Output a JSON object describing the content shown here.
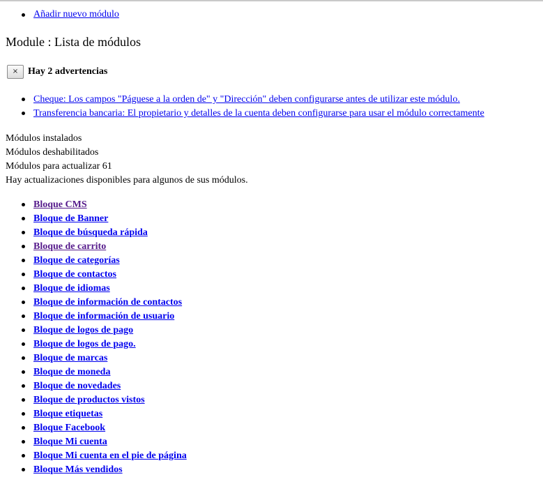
{
  "add_module_link": "Añadir nuevo módulo",
  "page_title": "Module : Lista de módulos",
  "warnings": {
    "close_symbol": "×",
    "title": "Hay 2 advertencias",
    "items": [
      "Cheque: Los campos \"Páguese a la orden de\" y \"Dirección\" deben configurarse antes de utilizar este módulo.",
      "Transferencia bancaria: El propietario y detalles de la cuenta deben configurarse para usar el módulo correctamente"
    ]
  },
  "status": {
    "installed": "Módulos instalados",
    "disabled": "Módulos deshabilitados",
    "to_update": "Módulos para actualizar 61",
    "updates_notice": "Hay actualizaciones disponibles para algunos de sus módulos."
  },
  "modules": [
    {
      "label": "Bloque CMS",
      "visited": true
    },
    {
      "label": "Bloque de Banner",
      "visited": false
    },
    {
      "label": "Bloque de búsqueda rápida",
      "visited": false
    },
    {
      "label": "Bloque de carrito",
      "visited": true
    },
    {
      "label": "Bloque de categorías",
      "visited": false
    },
    {
      "label": "Bloque de contactos",
      "visited": false
    },
    {
      "label": "Bloque de idiomas",
      "visited": false
    },
    {
      "label": "Bloque de información de contactos",
      "visited": false
    },
    {
      "label": "Bloque de información de usuario",
      "visited": false
    },
    {
      "label": "Bloque de logos de pago",
      "visited": false
    },
    {
      "label": "Bloque de logos de pago.",
      "visited": false
    },
    {
      "label": "Bloque de marcas",
      "visited": false
    },
    {
      "label": "Bloque de moneda",
      "visited": false
    },
    {
      "label": "Bloque de novedades",
      "visited": false
    },
    {
      "label": "Bloque de productos vistos",
      "visited": false
    },
    {
      "label": "Bloque etiquetas",
      "visited": false
    },
    {
      "label": "Bloque Facebook",
      "visited": false
    },
    {
      "label": "Bloque Mi cuenta",
      "visited": false
    },
    {
      "label": "Bloque Mi cuenta en el pie de página",
      "visited": false
    },
    {
      "label": "Bloque Más vendidos",
      "visited": false
    }
  ],
  "colors": {
    "link": "#0000ee",
    "visited_link": "#551a8b",
    "text": "#000000"
  }
}
